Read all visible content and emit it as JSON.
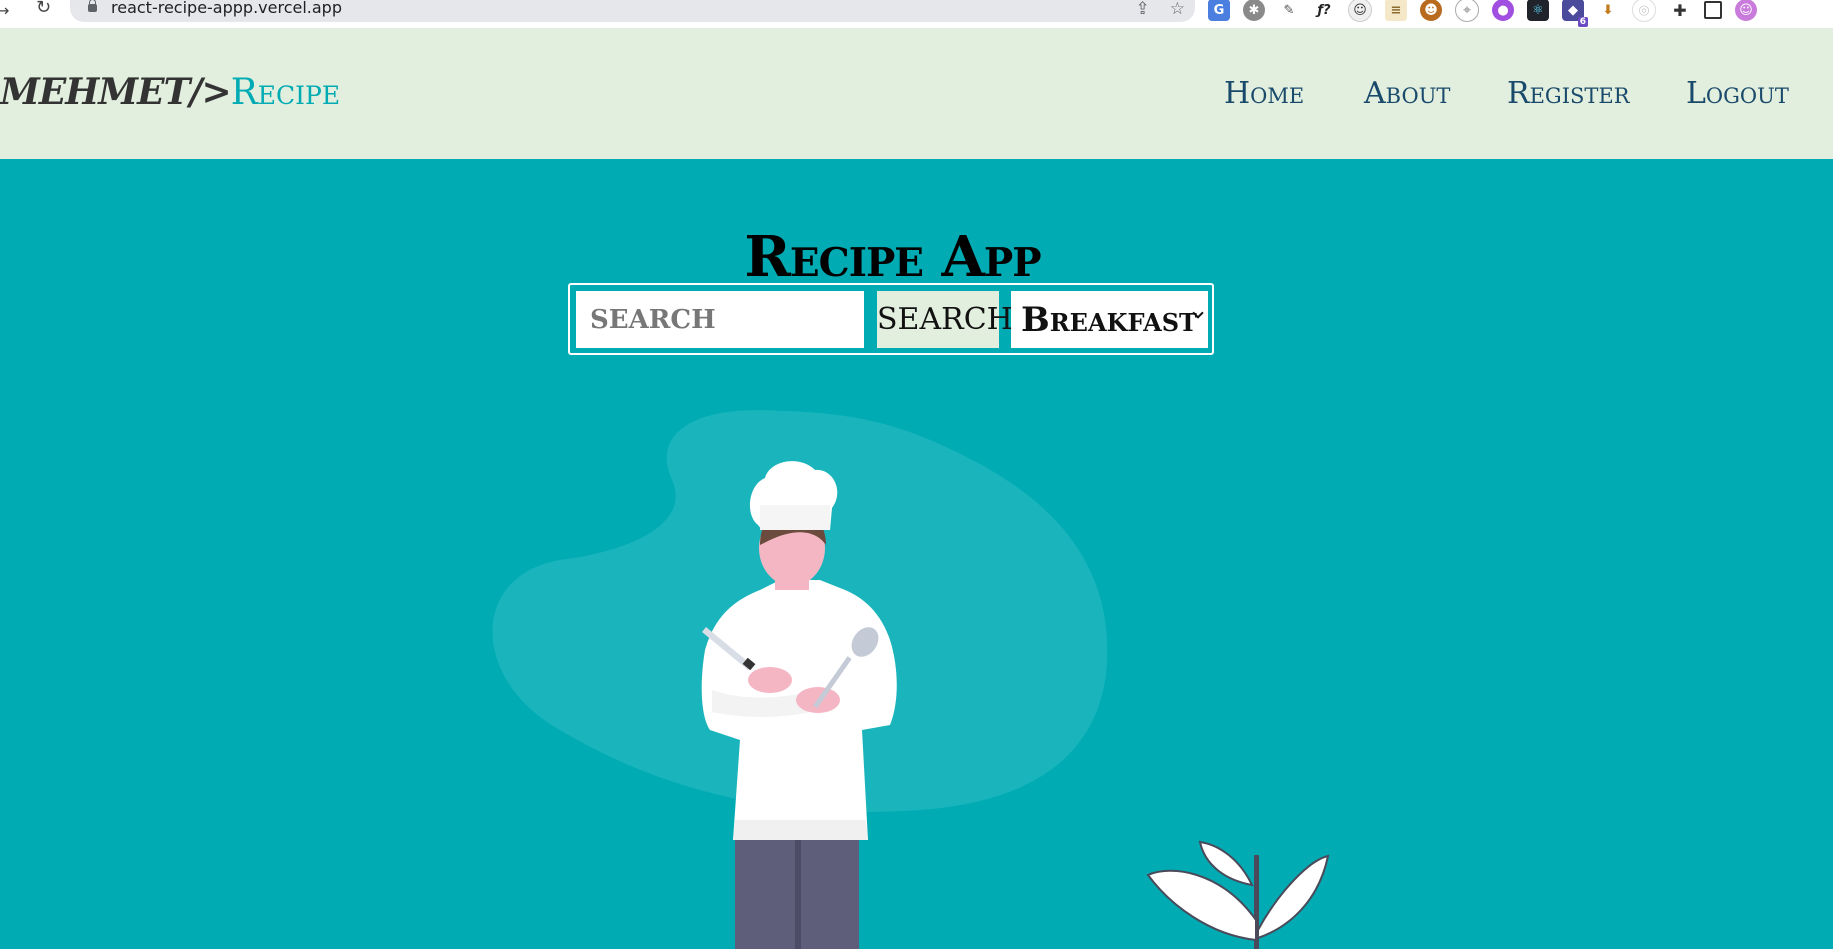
{
  "browser": {
    "url": "react-recipe-appp.vercel.app",
    "extension_badge": "6",
    "icons": [
      "back-arrow-icon",
      "reload-icon",
      "lock-icon",
      "share-icon",
      "bookmark-star-icon",
      "google-translate-icon",
      "bug-icon",
      "eyedropper-icon",
      "function-icon",
      "disguise-icon",
      "reader-icon",
      "profile-extension-icon",
      "compass-icon",
      "github-icon",
      "react-devtools-icon",
      "redux-icon",
      "download-icon",
      "circle-icon",
      "puzzle-icon",
      "sidebar-icon",
      "avatar-icon"
    ]
  },
  "header": {
    "brand_name": "MEHMET",
    "brand_sep": "/>",
    "brand_accent": "Recipe",
    "nav": {
      "home": "Home",
      "about": "About",
      "register": "Register",
      "logout": "Logout"
    },
    "background": "#e2efde",
    "link_color": "#1a4a6b"
  },
  "main": {
    "title": "Recipe App",
    "search": {
      "placeholder": "SEARCH",
      "value": "",
      "button_label": "SEARCH"
    },
    "meal_type": {
      "selected": "Breakfast"
    },
    "background": "#00abb3"
  },
  "illustration": {
    "subject": "chef-illustration",
    "plant": "plant-illustration"
  }
}
